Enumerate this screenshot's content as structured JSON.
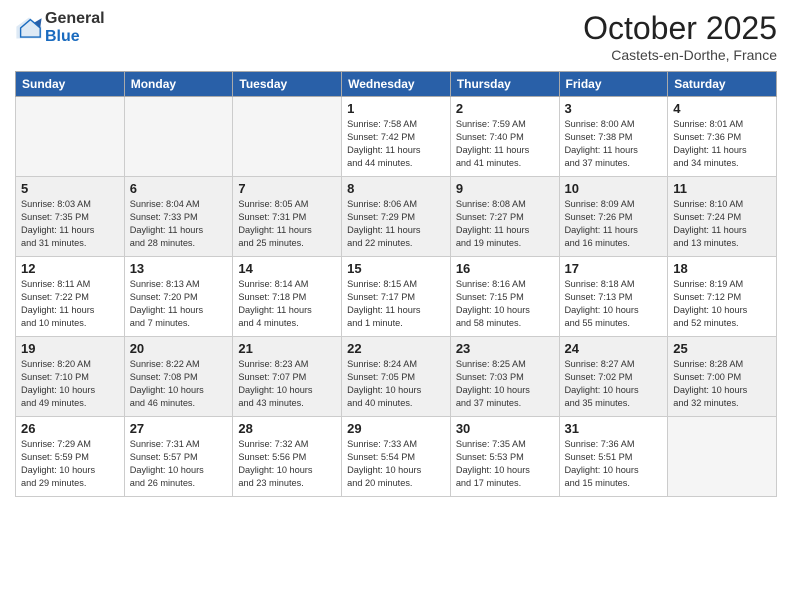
{
  "header": {
    "logo_general": "General",
    "logo_blue": "Blue",
    "month_title": "October 2025",
    "location": "Castets-en-Dorthe, France"
  },
  "days_of_week": [
    "Sunday",
    "Monday",
    "Tuesday",
    "Wednesday",
    "Thursday",
    "Friday",
    "Saturday"
  ],
  "weeks": [
    [
      {
        "day": "",
        "info": ""
      },
      {
        "day": "",
        "info": ""
      },
      {
        "day": "",
        "info": ""
      },
      {
        "day": "1",
        "info": "Sunrise: 7:58 AM\nSunset: 7:42 PM\nDaylight: 11 hours\nand 44 minutes."
      },
      {
        "day": "2",
        "info": "Sunrise: 7:59 AM\nSunset: 7:40 PM\nDaylight: 11 hours\nand 41 minutes."
      },
      {
        "day": "3",
        "info": "Sunrise: 8:00 AM\nSunset: 7:38 PM\nDaylight: 11 hours\nand 37 minutes."
      },
      {
        "day": "4",
        "info": "Sunrise: 8:01 AM\nSunset: 7:36 PM\nDaylight: 11 hours\nand 34 minutes."
      }
    ],
    [
      {
        "day": "5",
        "info": "Sunrise: 8:03 AM\nSunset: 7:35 PM\nDaylight: 11 hours\nand 31 minutes."
      },
      {
        "day": "6",
        "info": "Sunrise: 8:04 AM\nSunset: 7:33 PM\nDaylight: 11 hours\nand 28 minutes."
      },
      {
        "day": "7",
        "info": "Sunrise: 8:05 AM\nSunset: 7:31 PM\nDaylight: 11 hours\nand 25 minutes."
      },
      {
        "day": "8",
        "info": "Sunrise: 8:06 AM\nSunset: 7:29 PM\nDaylight: 11 hours\nand 22 minutes."
      },
      {
        "day": "9",
        "info": "Sunrise: 8:08 AM\nSunset: 7:27 PM\nDaylight: 11 hours\nand 19 minutes."
      },
      {
        "day": "10",
        "info": "Sunrise: 8:09 AM\nSunset: 7:26 PM\nDaylight: 11 hours\nand 16 minutes."
      },
      {
        "day": "11",
        "info": "Sunrise: 8:10 AM\nSunset: 7:24 PM\nDaylight: 11 hours\nand 13 minutes."
      }
    ],
    [
      {
        "day": "12",
        "info": "Sunrise: 8:11 AM\nSunset: 7:22 PM\nDaylight: 11 hours\nand 10 minutes."
      },
      {
        "day": "13",
        "info": "Sunrise: 8:13 AM\nSunset: 7:20 PM\nDaylight: 11 hours\nand 7 minutes."
      },
      {
        "day": "14",
        "info": "Sunrise: 8:14 AM\nSunset: 7:18 PM\nDaylight: 11 hours\nand 4 minutes."
      },
      {
        "day": "15",
        "info": "Sunrise: 8:15 AM\nSunset: 7:17 PM\nDaylight: 11 hours\nand 1 minute."
      },
      {
        "day": "16",
        "info": "Sunrise: 8:16 AM\nSunset: 7:15 PM\nDaylight: 10 hours\nand 58 minutes."
      },
      {
        "day": "17",
        "info": "Sunrise: 8:18 AM\nSunset: 7:13 PM\nDaylight: 10 hours\nand 55 minutes."
      },
      {
        "day": "18",
        "info": "Sunrise: 8:19 AM\nSunset: 7:12 PM\nDaylight: 10 hours\nand 52 minutes."
      }
    ],
    [
      {
        "day": "19",
        "info": "Sunrise: 8:20 AM\nSunset: 7:10 PM\nDaylight: 10 hours\nand 49 minutes."
      },
      {
        "day": "20",
        "info": "Sunrise: 8:22 AM\nSunset: 7:08 PM\nDaylight: 10 hours\nand 46 minutes."
      },
      {
        "day": "21",
        "info": "Sunrise: 8:23 AM\nSunset: 7:07 PM\nDaylight: 10 hours\nand 43 minutes."
      },
      {
        "day": "22",
        "info": "Sunrise: 8:24 AM\nSunset: 7:05 PM\nDaylight: 10 hours\nand 40 minutes."
      },
      {
        "day": "23",
        "info": "Sunrise: 8:25 AM\nSunset: 7:03 PM\nDaylight: 10 hours\nand 37 minutes."
      },
      {
        "day": "24",
        "info": "Sunrise: 8:27 AM\nSunset: 7:02 PM\nDaylight: 10 hours\nand 35 minutes."
      },
      {
        "day": "25",
        "info": "Sunrise: 8:28 AM\nSunset: 7:00 PM\nDaylight: 10 hours\nand 32 minutes."
      }
    ],
    [
      {
        "day": "26",
        "info": "Sunrise: 7:29 AM\nSunset: 5:59 PM\nDaylight: 10 hours\nand 29 minutes."
      },
      {
        "day": "27",
        "info": "Sunrise: 7:31 AM\nSunset: 5:57 PM\nDaylight: 10 hours\nand 26 minutes."
      },
      {
        "day": "28",
        "info": "Sunrise: 7:32 AM\nSunset: 5:56 PM\nDaylight: 10 hours\nand 23 minutes."
      },
      {
        "day": "29",
        "info": "Sunrise: 7:33 AM\nSunset: 5:54 PM\nDaylight: 10 hours\nand 20 minutes."
      },
      {
        "day": "30",
        "info": "Sunrise: 7:35 AM\nSunset: 5:53 PM\nDaylight: 10 hours\nand 17 minutes."
      },
      {
        "day": "31",
        "info": "Sunrise: 7:36 AM\nSunset: 5:51 PM\nDaylight: 10 hours\nand 15 minutes."
      },
      {
        "day": "",
        "info": ""
      }
    ]
  ]
}
